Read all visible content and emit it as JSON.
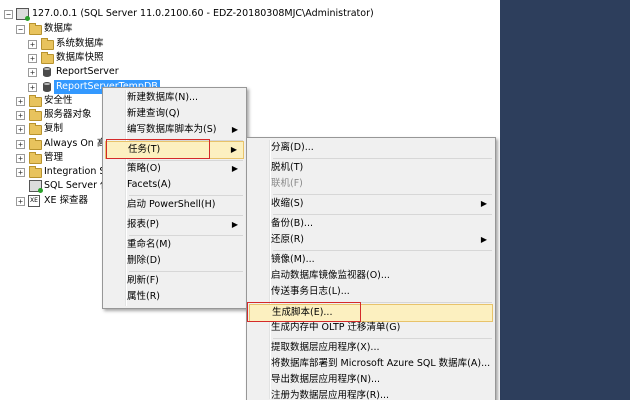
{
  "tree": {
    "root": "127.0.0.1 (SQL Server 11.0.2100.60 - EDZ-20180308MJC\\Administrator)",
    "databases": "数据库",
    "system_databases": "系统数据库",
    "db_snapshots": "数据库快照",
    "report_server": "ReportServer",
    "report_server_tempdb": "ReportServerTempDB",
    "security": "安全性",
    "server_objects": "服务器对象",
    "replication": "复制",
    "always_on": "Always On 高可",
    "management": "管理",
    "integration": "Integration Se",
    "sql_agent": "SQL Server 代",
    "xe_profiler": "XE 探查器",
    "xe_badge": "XE"
  },
  "context_menu": {
    "items": [
      {
        "label": "新建数据库(N)..."
      },
      {
        "label": "新建查询(Q)"
      },
      {
        "label": "编写数据库脚本为(S)",
        "submenu": true
      },
      {
        "label": "任务(T)",
        "submenu": true
      },
      {
        "label": "策略(O)",
        "submenu": true
      },
      {
        "label": "Facets(A)"
      },
      {
        "label": "启动 PowerShell(H)"
      },
      {
        "label": "报表(P)",
        "submenu": true
      },
      {
        "label": "重命名(M)"
      },
      {
        "label": "删除(D)"
      },
      {
        "label": "刷新(F)"
      },
      {
        "label": "属性(R)"
      }
    ]
  },
  "tasks_menu": {
    "items": [
      {
        "label": "分离(D)..."
      },
      {
        "label": "脱机(T)"
      },
      {
        "label": "联机(F)",
        "disabled": true
      },
      {
        "label": "收缩(S)",
        "submenu": true
      },
      {
        "label": "备份(B)..."
      },
      {
        "label": "还原(R)",
        "submenu": true
      },
      {
        "label": "镜像(M)..."
      },
      {
        "label": "启动数据库镜像监视器(O)..."
      },
      {
        "label": "传送事务日志(L)..."
      },
      {
        "label": "生成脚本(E)..."
      },
      {
        "label": "生成内存中 OLTP 迁移清单(G)"
      },
      {
        "label": "提取数据层应用程序(X)..."
      },
      {
        "label": "将数据库部署到 Microsoft Azure SQL 数据库(A)..."
      },
      {
        "label": "导出数据层应用程序(N)..."
      },
      {
        "label": "注册为数据层应用程序(R)..."
      }
    ]
  },
  "arrow_glyph": "▶",
  "colors": {
    "highlight": "#fcf0c0",
    "annotation_red": "#d42a2a",
    "selection": "#3399ff"
  }
}
